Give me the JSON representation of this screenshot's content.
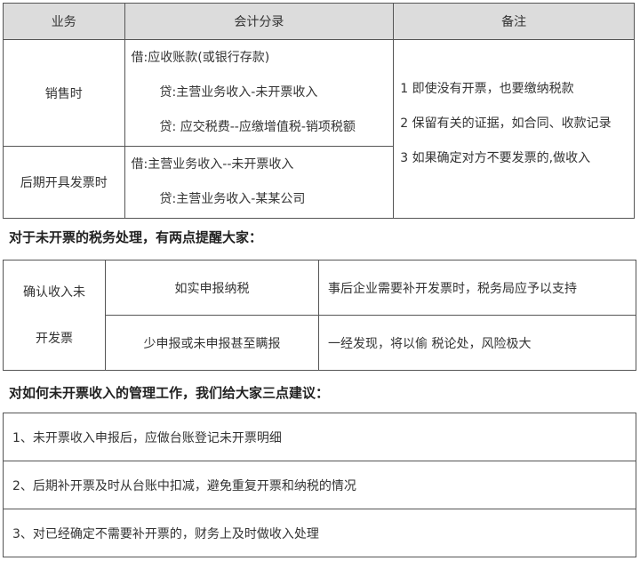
{
  "table1": {
    "headers": [
      "业务",
      "会计分录",
      "备注"
    ],
    "rows": [
      {
        "business": "销售时",
        "entries": [
          "借:应收账款(或银行存款)",
          "贷:主营业务收入-未开票收入",
          "贷: 应交税费--应缴增值税-销项税额"
        ]
      },
      {
        "business": "后期开具发票时",
        "entries": [
          "借:主营业务收入--未开票收入",
          "贷:主营业务收入-某某公司"
        ]
      }
    ],
    "notes": [
      "1 即使没有开票，也要缴纳税款",
      "2 保留有关的证据，如合同、收款记录",
      "3 如果确定对方不要发票的,做收入"
    ]
  },
  "heading1": "对于未开票的税务处理，有两点提醒大家：",
  "table2": {
    "left_line1": "确认收入未",
    "left_line2": "开发票",
    "rows": [
      {
        "action": "如实申报纳税",
        "result": "事后企业需要补开发票时，税务局应予以支持"
      },
      {
        "action": "少申报或未申报甚至瞒报",
        "result": "一经发现，将以偷 税论处，风险极大"
      }
    ]
  },
  "heading2": "对如何未开票收入的管理工作，我们给大家三点建议：",
  "suggestions": [
    "1、未开票收入申报后，应做台账登记未开票明细",
    "2、后期补开票及时从台账中扣减，避免重复开票和纳税的情况",
    "3、对已经确定不需要补开票的，财务上及时做收入处理"
  ]
}
